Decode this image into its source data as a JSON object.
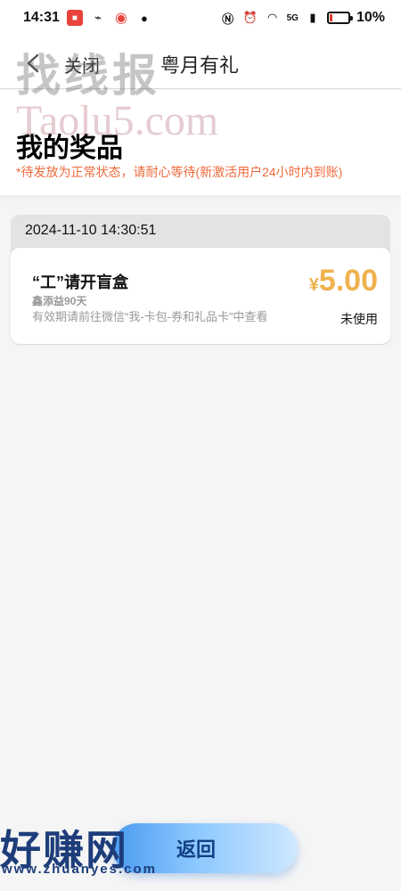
{
  "status_bar": {
    "time": "14:31",
    "network": "5G",
    "battery": "10%"
  },
  "nav": {
    "close_label": "关闭",
    "title": "粤月有礼"
  },
  "watermark": {
    "top": "找线报",
    "sub": "Taolu5.com",
    "bottom": "好赚网",
    "bottom_url": "www.zhuanyes.com"
  },
  "header": {
    "title": "我的奖品",
    "notice": "*待发放为正常状态，请耐心等待(新激活用户24小时内到账)"
  },
  "records": [
    {
      "time": "2024-11-10 14:30:51",
      "prize": {
        "name": "“工”请开盲盒",
        "sub": "鑫添益90天",
        "note": "有效期请前往微信“我-卡包-券和礼品卡”中查看",
        "currency": "¥",
        "amount": "5.00",
        "status": "未使用"
      }
    }
  ],
  "footer": {
    "return_label": "返回"
  },
  "colors": {
    "accent_price": "#efb24e",
    "notice": "#ef6a3c",
    "button_blue": "#4b9bf0"
  }
}
